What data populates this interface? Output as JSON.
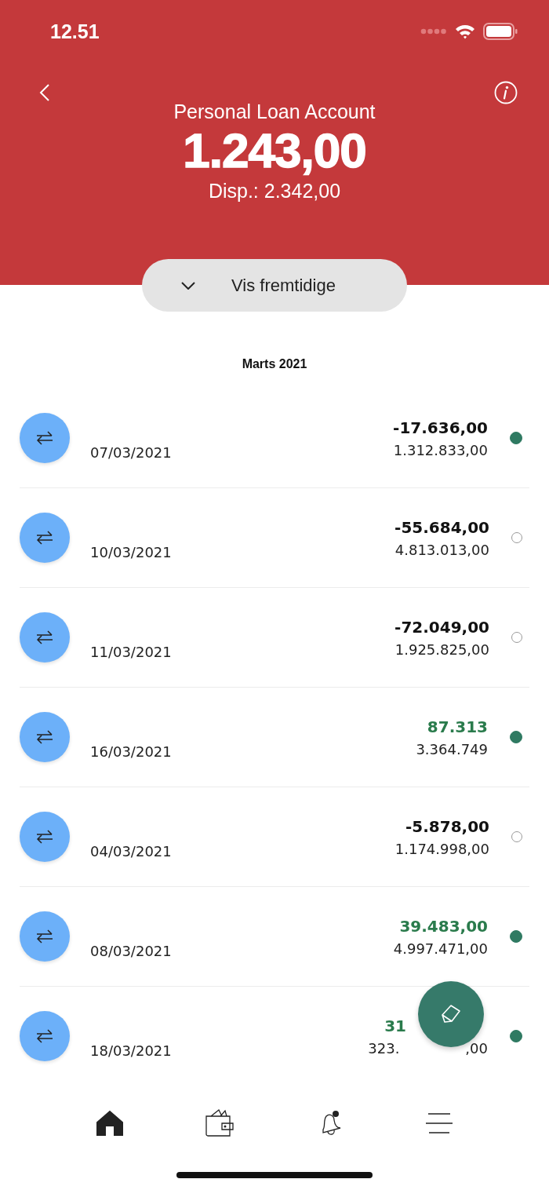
{
  "status_bar": {
    "time": "12.51"
  },
  "header": {
    "title": "Personal Loan Account",
    "balance": "1.243,00",
    "available": "Disp.: 2.342,00"
  },
  "future_toggle": {
    "label": "Vis fremtidige"
  },
  "section": {
    "title": "Marts 2021"
  },
  "transactions": [
    {
      "date": "07/03/2021",
      "amount": "-17.636,00",
      "balance": "1.312.833,00",
      "incoming": false,
      "cleared": true
    },
    {
      "date": "10/03/2021",
      "amount": "-55.684,00",
      "balance": "4.813.013,00",
      "incoming": false,
      "cleared": false
    },
    {
      "date": "11/03/2021",
      "amount": "-72.049,00",
      "balance": "1.925.825,00",
      "incoming": false,
      "cleared": false
    },
    {
      "date": "16/03/2021",
      "amount": "87.313",
      "balance": "3.364.749",
      "incoming": true,
      "cleared": true
    },
    {
      "date": "04/03/2021",
      "amount": "-5.878,00",
      "balance": "1.174.998,00",
      "incoming": false,
      "cleared": false
    },
    {
      "date": "08/03/2021",
      "amount": "39.483,00",
      "balance": "4.997.471,00",
      "incoming": true,
      "cleared": true
    },
    {
      "date": "18/03/2021",
      "amount": "31",
      "balance": "323.",
      "balance_tail": ",00",
      "incoming": true,
      "cleared": true
    }
  ],
  "nav": [
    {
      "kind": "home"
    },
    {
      "kind": "wallet"
    },
    {
      "kind": "bell"
    },
    {
      "kind": "menu"
    }
  ]
}
